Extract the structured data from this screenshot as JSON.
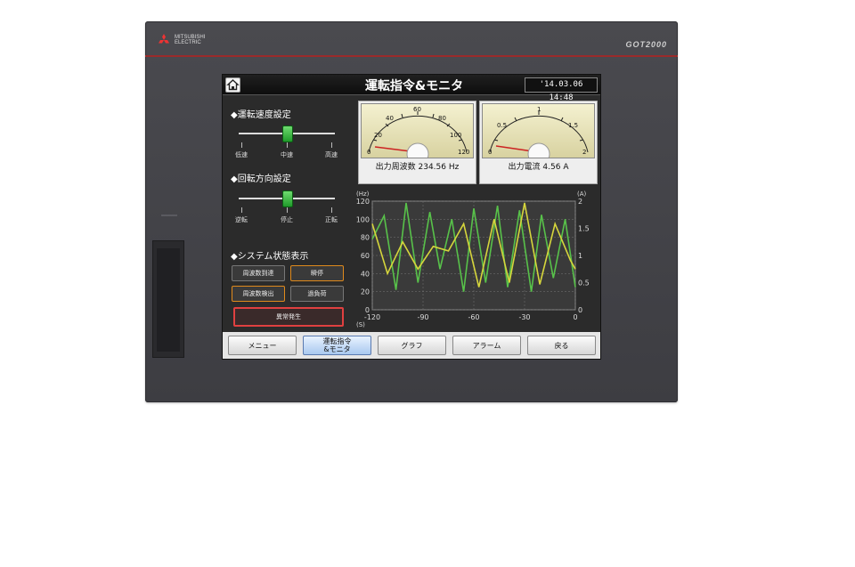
{
  "device": {
    "brand_line1": "MITSUBISHI",
    "brand_line2": "ELECTRIC",
    "model": "GOT2000"
  },
  "header": {
    "title": "運転指令&モニタ",
    "datetime": "'14.03.06 14:48",
    "home_icon": "home-icon"
  },
  "speed_setting": {
    "heading": "◆運転速度設定",
    "labels": [
      "低速",
      "中速",
      "高速"
    ],
    "selected": "中速"
  },
  "direction_setting": {
    "heading": "◆回転方向設定",
    "labels": [
      "逆転",
      "停止",
      "正転"
    ],
    "selected": "停止"
  },
  "status": {
    "heading": "◆システム状態表示",
    "lamps": [
      {
        "label": "周波数到達",
        "style": "plain"
      },
      {
        "label": "瞬停",
        "style": "orange"
      },
      {
        "label": "周波数検出",
        "style": "orange"
      },
      {
        "label": "過負荷",
        "style": "plain"
      }
    ],
    "alarm_label": "異常発生"
  },
  "meters": [
    {
      "ticks": [
        "0",
        "20",
        "40",
        "60",
        "80",
        "100",
        "120"
      ],
      "readout_label": "出力周波数",
      "value": "234.56",
      "unit": "Hz"
    },
    {
      "ticks": [
        "0",
        "0.5",
        "1",
        "1.5",
        "2"
      ],
      "readout_label": "出力電流",
      "value": "4.56",
      "unit": "A"
    }
  ],
  "chart_data": {
    "type": "line",
    "left_unit": "(Hz)",
    "right_unit": "(A)",
    "x_unit": "(S)",
    "xlim": [
      -120,
      0
    ],
    "ylim_left": [
      0,
      120
    ],
    "ylim_right": [
      0,
      2
    ],
    "x_ticks": [
      "-120",
      "-90",
      "-60",
      "-30",
      "0"
    ],
    "y_ticks_left": [
      "0",
      "20",
      "40",
      "60",
      "80",
      "100",
      "120"
    ],
    "y_ticks_right": [
      "0",
      "0.5",
      "1",
      "1.5",
      "2"
    ],
    "grid": true,
    "series": [
      {
        "color": "#58c24a",
        "axis": "left",
        "x": [
          -120,
          -113,
          -106,
          -100,
          -93,
          -86,
          -80,
          -73,
          -66,
          -60,
          -53,
          -46,
          -40,
          -33,
          -26,
          -20,
          -13,
          -6,
          0
        ],
        "values": [
          78,
          104,
          22,
          118,
          30,
          108,
          45,
          100,
          20,
          112,
          30,
          115,
          25,
          110,
          20,
          105,
          35,
          100,
          25
        ]
      },
      {
        "color": "#d6d63c",
        "axis": "left",
        "x": [
          -120,
          -111,
          -102,
          -93,
          -84,
          -75,
          -66,
          -57,
          -48,
          -39,
          -30,
          -21,
          -12,
          -3,
          0
        ],
        "values": [
          95,
          40,
          75,
          45,
          70,
          65,
          95,
          25,
          100,
          30,
          118,
          28,
          95,
          55,
          45
        ]
      }
    ]
  },
  "tabs": [
    {
      "label": "メニュー",
      "active": false
    },
    {
      "label": "運転指令&モニタ",
      "active": true
    },
    {
      "label": "グラフ",
      "active": false
    },
    {
      "label": "アラーム",
      "active": false
    },
    {
      "label": "戻る",
      "active": false
    }
  ]
}
